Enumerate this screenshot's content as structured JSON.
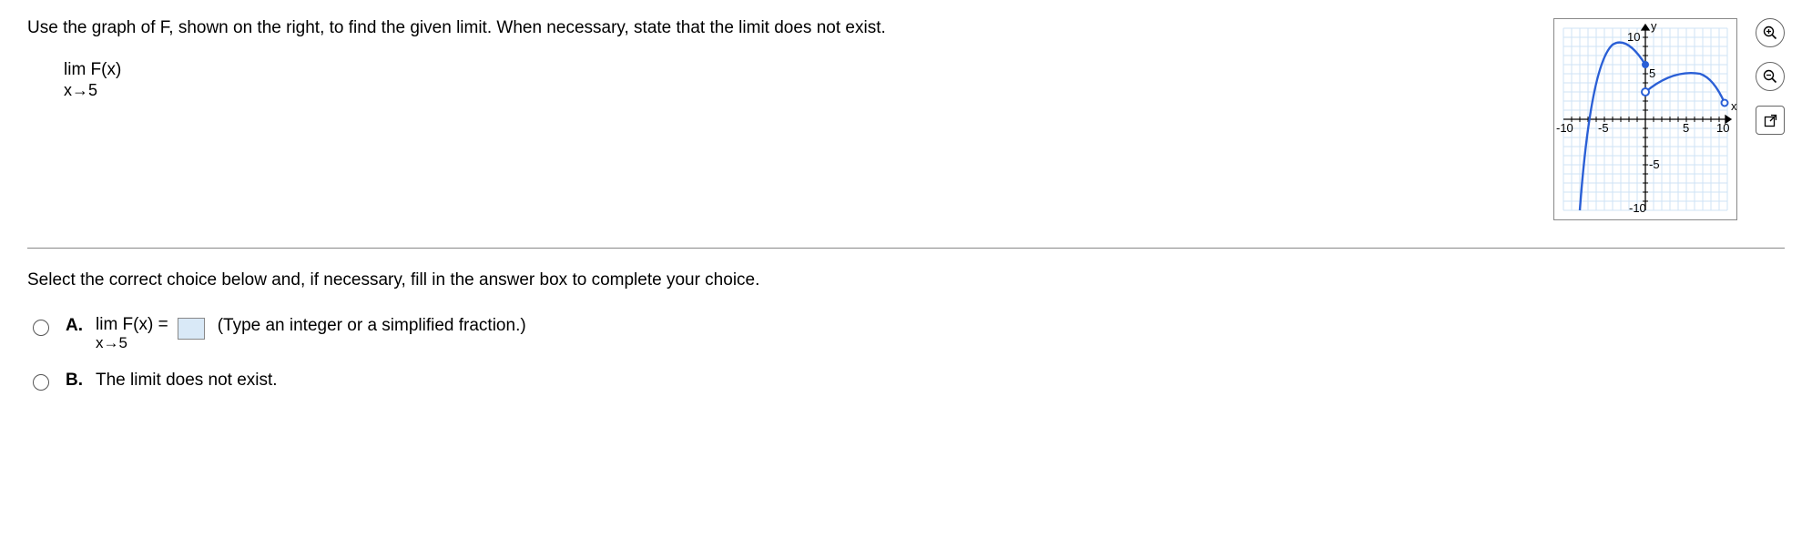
{
  "question": {
    "prompt": "Use the graph of F, shown on the right, to find the given limit. When necessary, state that the limit does not exist.",
    "limit_top": "lim F(x)",
    "limit_bottom": "x→5"
  },
  "graph": {
    "x_label": "x",
    "y_label": "y",
    "ticks": {
      "x_min": "-10",
      "x_neg": "-5",
      "x_pos": "5",
      "x_max": "10",
      "y_min": "-10",
      "y_neg": "-5",
      "y_pos": "5",
      "y_max": "10"
    }
  },
  "tools": {
    "zoom_in": "zoom-in",
    "zoom_out": "zoom-out",
    "open": "open-new"
  },
  "lower": {
    "instruction": "Select the correct choice below and, if necessary, fill in the answer box to complete your choice.",
    "choice_a": {
      "letter": "A.",
      "limit_top": "lim F(x) =",
      "limit_bottom": "x→5",
      "hint": "(Type an integer or a simplified fraction.)"
    },
    "choice_b": {
      "letter": "B.",
      "text": "The limit does not exist."
    }
  },
  "chart_data": {
    "type": "line",
    "title": "",
    "xlabel": "x",
    "ylabel": "y",
    "xlim": [
      -10,
      10
    ],
    "ylim": [
      -10,
      10
    ],
    "series": [
      {
        "name": "left-branch",
        "points": [
          [
            -8,
            -10
          ],
          [
            -7,
            0
          ],
          [
            -6,
            5
          ],
          [
            -5,
            7.5
          ],
          [
            -4,
            8.5
          ],
          [
            -3,
            8.8
          ],
          [
            -2,
            8.5
          ],
          [
            -1,
            7.5
          ],
          [
            0,
            6
          ]
        ],
        "end_point": {
          "x": 0,
          "y": 6,
          "filled": true
        }
      },
      {
        "name": "right-branch",
        "points": [
          [
            0,
            3
          ],
          [
            2,
            4
          ],
          [
            4,
            5
          ],
          [
            6,
            5
          ],
          [
            8,
            4
          ],
          [
            10,
            2
          ]
        ],
        "start_point": {
          "x": 0,
          "y": 3,
          "filled": false
        }
      }
    ]
  }
}
